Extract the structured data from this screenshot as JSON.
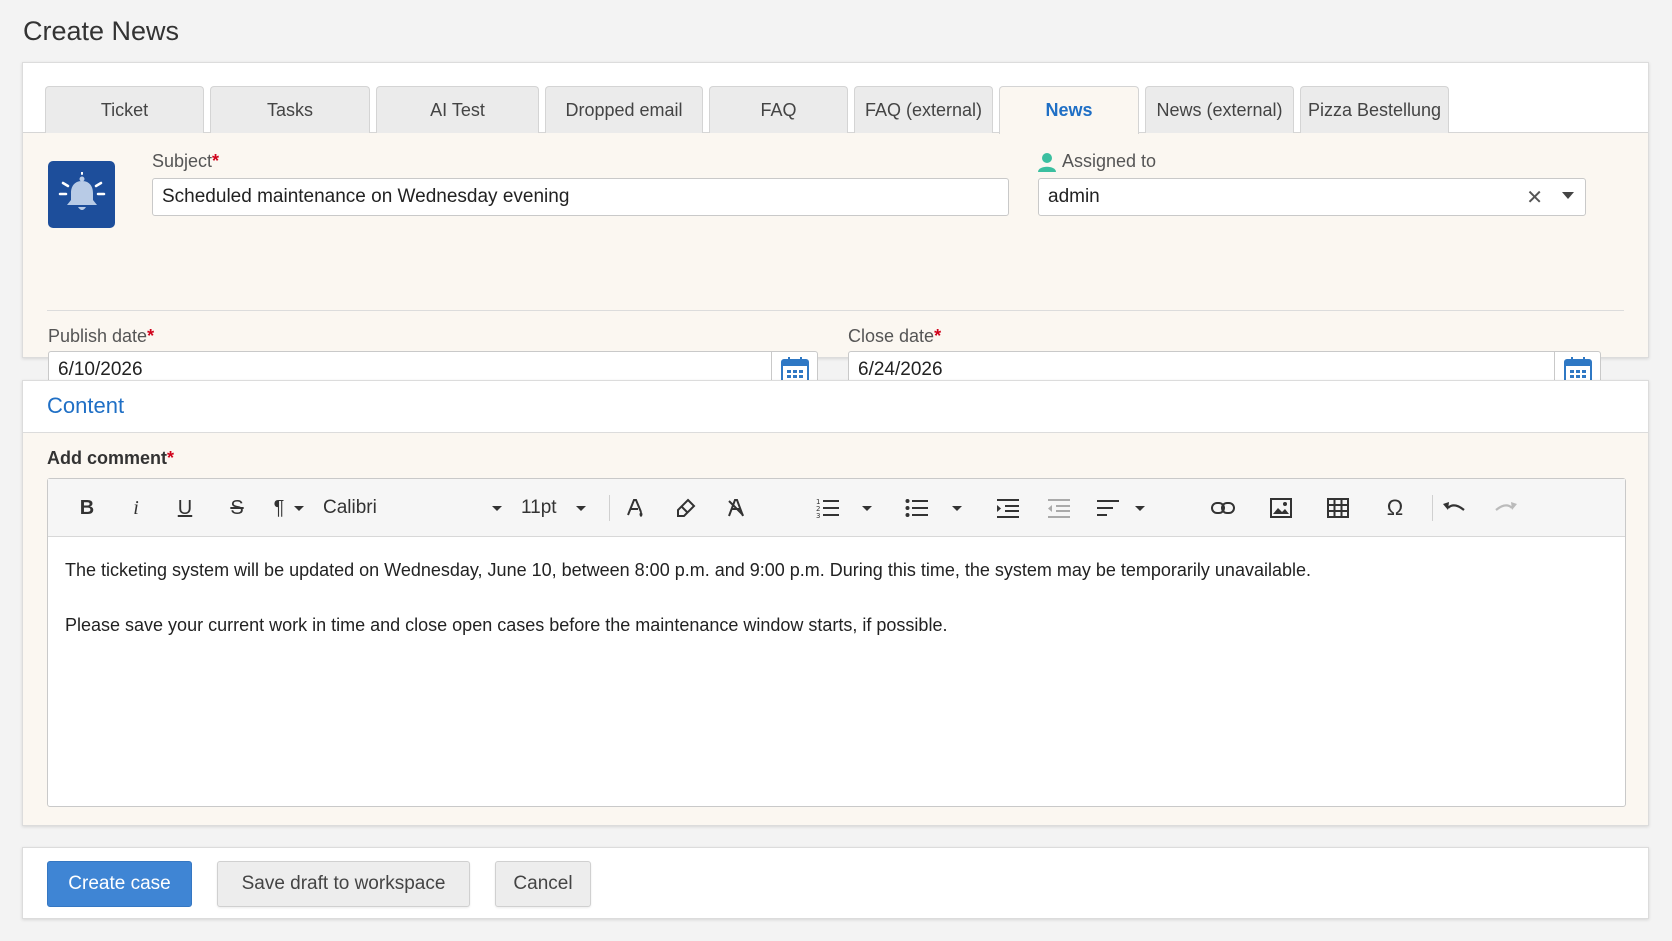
{
  "page_title": "Create News",
  "tabs": [
    {
      "label": "Ticket"
    },
    {
      "label": "Tasks"
    },
    {
      "label": "AI Test"
    },
    {
      "label": "Dropped email"
    },
    {
      "label": "FAQ"
    },
    {
      "label": "FAQ (external)"
    },
    {
      "label": "News"
    },
    {
      "label": "News (external)"
    },
    {
      "label": "Pizza Bestellung"
    }
  ],
  "active_tab": "News",
  "form": {
    "subject_label": "Subject",
    "subject_value": "Scheduled maintenance on Wednesday evening",
    "assigned_label": "Assigned to",
    "assigned_value": "admin",
    "publish_label": "Publish date",
    "publish_value": "6/10/2026",
    "close_label": "Close date",
    "close_value": "6/24/2026",
    "required_mark": "*"
  },
  "content": {
    "title": "Content",
    "comment_label": "Add comment",
    "toolbar": {
      "font": "Calibri",
      "size": "11pt",
      "bold": "B",
      "italic": "i",
      "underline": "U",
      "strike": "S",
      "paragraph": "¶",
      "omega": "Ω"
    },
    "paragraphs": [
      "The ticketing system will be updated on Wednesday, June 10, between 8:00 p.m. and 9:00 p.m. During this time, the system may be temporarily unavailable.",
      "Please save your current work in time and close open cases before the maintenance window starts, if possible."
    ]
  },
  "actions": {
    "create": "Create case",
    "save_draft": "Save draft to workspace",
    "cancel": "Cancel"
  },
  "colors": {
    "accent": "#1f6fc5",
    "primary_button": "#3f85d4",
    "icon_bg": "#1d4e9b",
    "required": "#d0021b"
  }
}
